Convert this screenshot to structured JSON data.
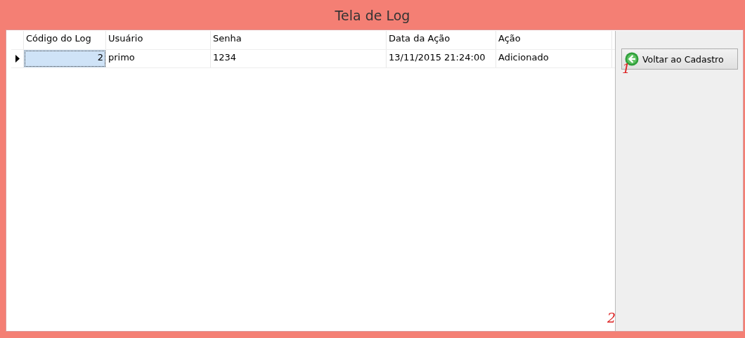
{
  "window": {
    "title": "Tela de Log"
  },
  "grid": {
    "columns": [
      {
        "label": "Código do Log",
        "kind": "number"
      },
      {
        "label": "Usuário",
        "kind": "text"
      },
      {
        "label": "Senha",
        "kind": "text"
      },
      {
        "label": "Data da Ação",
        "kind": "text"
      },
      {
        "label": "Ação",
        "kind": "text"
      }
    ],
    "rows": [
      {
        "selected": true,
        "cells": [
          "2",
          "primo",
          "1234",
          "13/11/2015 21:24:00",
          "Adicionado"
        ]
      }
    ]
  },
  "buttons": [
    {
      "label": "Voltar ao Cadastro"
    }
  ],
  "annotations": [
    "1",
    "2"
  ]
}
